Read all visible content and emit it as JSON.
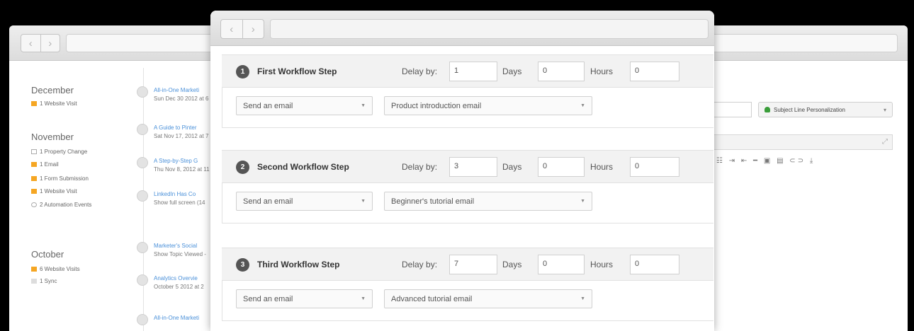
{
  "back_window": {
    "timeline": {
      "months": [
        {
          "name": "December",
          "events": [
            {
              "icon": "orange-square-icon",
              "label": "1 Website Visit"
            }
          ]
        },
        {
          "name": "November",
          "events": [
            {
              "icon": "flag-icon",
              "label": "1 Property Change"
            },
            {
              "icon": "email-icon",
              "label": "1 Email"
            },
            {
              "icon": "form-icon",
              "label": "1 Form Submission"
            },
            {
              "icon": "orange-square-icon",
              "label": "1 Website Visit"
            },
            {
              "icon": "clock-icon",
              "label": "2 Automation Events"
            }
          ]
        },
        {
          "name": "October",
          "events": [
            {
              "icon": "orange-square-icon",
              "label": "6 Website Visits"
            },
            {
              "icon": "sync-icon",
              "label": "1 Sync"
            }
          ]
        }
      ],
      "items": [
        {
          "title": "All-in-One Marketi",
          "sub": "Sun Dec 30 2012 at 6"
        },
        {
          "title": "A Guide to Pinter",
          "sub": "Sat Nov 17, 2012 at 7"
        },
        {
          "title": "A Step-by-Step G",
          "sub": "Thu Nov 8, 2012 at 11"
        },
        {
          "title": "LinkedIn Has Co",
          "sub": "Show full screen (14"
        },
        {
          "title": "Marketer's Social",
          "sub": "Show Topic Viewed -"
        },
        {
          "title": "Analytics Overvie",
          "sub": "October 5 2012 at 2"
        },
        {
          "title": "All-in-One Marketi",
          "sub": ""
        }
      ]
    },
    "subject_button": "Subject Line Personalization",
    "editor_tools": "☷ ⇥ ⇤ ━ ▣ ▤ ⊂⊃ ⤓"
  },
  "front_window": {
    "steps": [
      {
        "number": "1",
        "title": "First Workflow Step",
        "delay_label": "Delay by:",
        "delay": "1",
        "days_label": "Days",
        "days": "0",
        "hours_label": "Hours",
        "hours": "0",
        "action": "Send an email",
        "email": "Product introduction email"
      },
      {
        "number": "2",
        "title": "Second Workflow Step",
        "delay_label": "Delay by:",
        "delay": "3",
        "days_label": "Days",
        "days": "0",
        "hours_label": "Hours",
        "hours": "0",
        "action": "Send an email",
        "email": "Beginner's tutorial email"
      },
      {
        "number": "3",
        "title": "Third Workflow Step",
        "delay_label": "Delay by:",
        "delay": "7",
        "days_label": "Days",
        "days": "0",
        "hours_label": "Hours",
        "hours": "0",
        "action": "Send an email",
        "email": "Advanced tutorial email"
      }
    ]
  },
  "colors": {
    "accent_orange": "#f5a623",
    "link_blue": "#4a90d9",
    "badge_dark": "#555555"
  }
}
